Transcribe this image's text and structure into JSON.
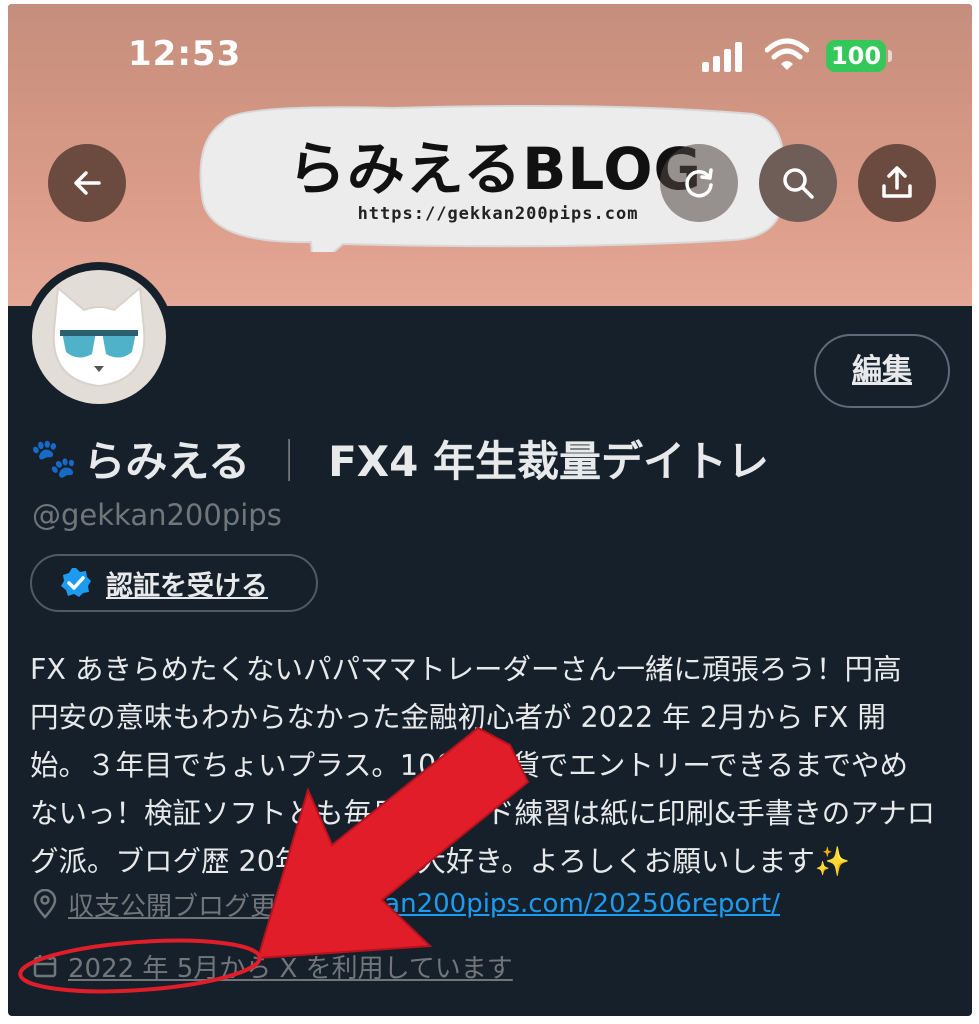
{
  "status_bar": {
    "time": "12:53",
    "battery": "100"
  },
  "banner": {
    "title": "らみえるBLOG",
    "url": "https://gekkan200pips.com"
  },
  "profile": {
    "edit_label": "編集",
    "display_name": "らみえる",
    "name_separator": "｜",
    "display_name_suffix": "FX4 年生裁量デイトレ",
    "handle": "@gekkan200pips",
    "verify_label": "認証を受ける",
    "bio_lines": [
      "FX あきらめたくないパパママトレーダーさん一緒に頑張ろう！円高",
      "円安の意味もわからなかった金融初心者が 2022 年 2月から FX 開",
      "始。３年目でちょいプラス。100万通貨でエントリーできるまでやめ",
      "ないっ！検証ソフトとも毎日トレード練習は紙に印刷&手書きのアナロ",
      "グ派。ブログ歴 20年、ブログ大好き。よろしくお願いします"
    ],
    "bio_emoji": "✨",
    "location_label": "収支公開ブログ更新",
    "location_link": "gekkan200pips.com/202506report/",
    "joined_label": "2022 年 5月から X を利用しています"
  },
  "colors": {
    "background": "#15202b",
    "accent_link": "#1d9bf0",
    "verified_badge": "#1d9bf0",
    "annotation_red": "#e11d2a"
  },
  "icons": [
    "back-arrow-icon",
    "refresh-icon",
    "search-icon",
    "share-icon",
    "verified-badge-icon",
    "location-pin-icon",
    "calendar-icon",
    "paw-icon",
    "signal-icon",
    "wifi-icon"
  ]
}
